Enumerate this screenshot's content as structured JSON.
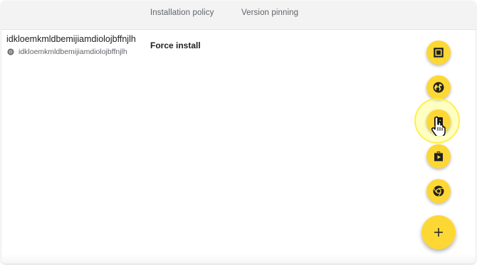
{
  "table": {
    "columns": [
      "Installation policy",
      "Version pinning"
    ],
    "rows": [
      {
        "name": "idkloemkmldbemijiamdiolojbffnjlh",
        "id": "idkloemkmldbemijiamdiolojbffnjlh",
        "id_icon": "chrome-icon",
        "policy": "Force install"
      }
    ]
  },
  "fab_menu": {
    "items": [
      {
        "icon": "kiosk-app-icon"
      },
      {
        "icon": "globe-icon"
      },
      {
        "icon": "android-app-icon"
      },
      {
        "icon": "play-store-icon"
      },
      {
        "icon": "chrome-icon"
      }
    ],
    "main_icon": "plus-icon",
    "accent_color": "#fdd835",
    "highlighted_item": "android-app-icon"
  }
}
